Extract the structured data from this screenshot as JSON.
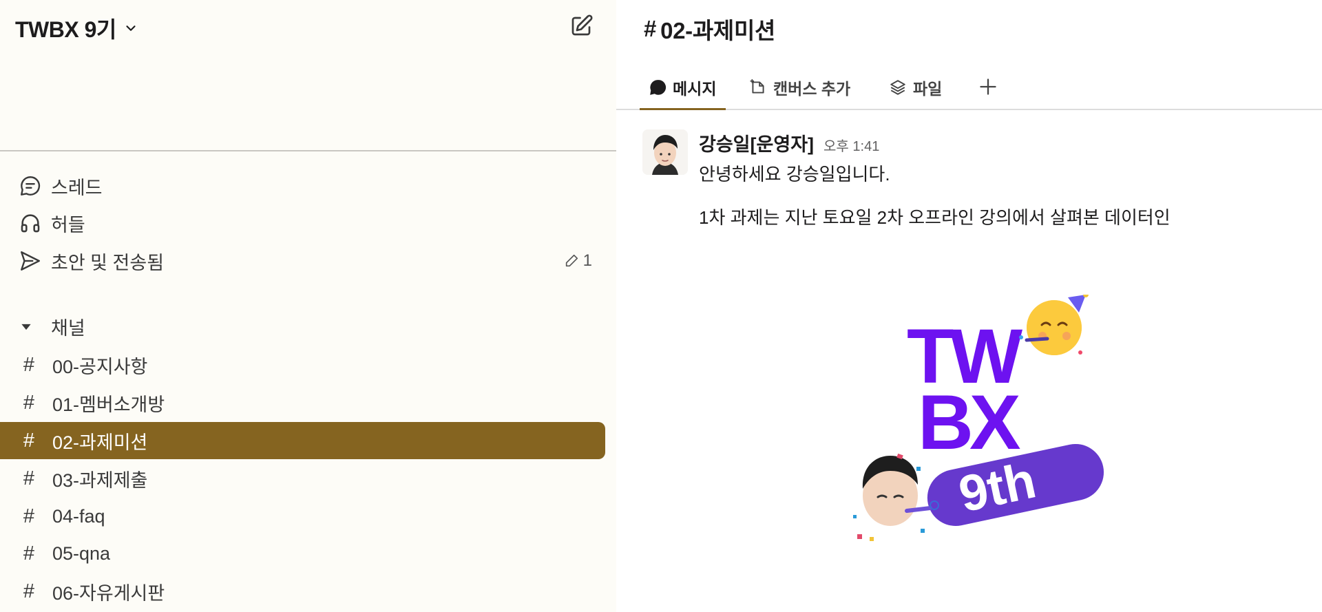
{
  "workspace": {
    "name": "TWBX 9기"
  },
  "nav": {
    "threads_label": "스레드",
    "huddles_label": "허들",
    "drafts_label": "초안 및 전송됨",
    "drafts_count": "1"
  },
  "channels_section": {
    "label": "채널"
  },
  "channels": [
    {
      "name": "00-공지사항"
    },
    {
      "name": "01-멤버소개방"
    },
    {
      "name": "02-과제미션"
    },
    {
      "name": "03-과제제출"
    },
    {
      "name": "04-faq"
    },
    {
      "name": "05-qna"
    },
    {
      "name": "06-자유게시판"
    }
  ],
  "active_channel": "02-과제미션",
  "channel_header": {
    "hash": "#",
    "title": "02-과제미션"
  },
  "tabs": [
    {
      "label": "메시지"
    },
    {
      "label": "캔버스 추가"
    },
    {
      "label": "파일"
    }
  ],
  "message": {
    "author": "강승일[운영자]",
    "time": "오후 1:41",
    "line1": "안녕하세요 강승일입니다.",
    "line2": "1차 과제는 지난 토요일 2차 오프라인 강의에서 살펴본 데이터인"
  },
  "banner": {
    "word1": "TW",
    "word2": "BX",
    "badge": "9th"
  },
  "colors": {
    "accent": "#856420",
    "sidebar_bg": "#fdfcf7",
    "banner_purple": "#6d12f0"
  },
  "icons": [
    "chevron-down-icon",
    "compose-icon",
    "thread-icon",
    "headphones-icon",
    "send-icon",
    "pencil-icon",
    "caret-down-icon",
    "message-icon",
    "canvas-icon",
    "files-icon",
    "plus-icon"
  ]
}
